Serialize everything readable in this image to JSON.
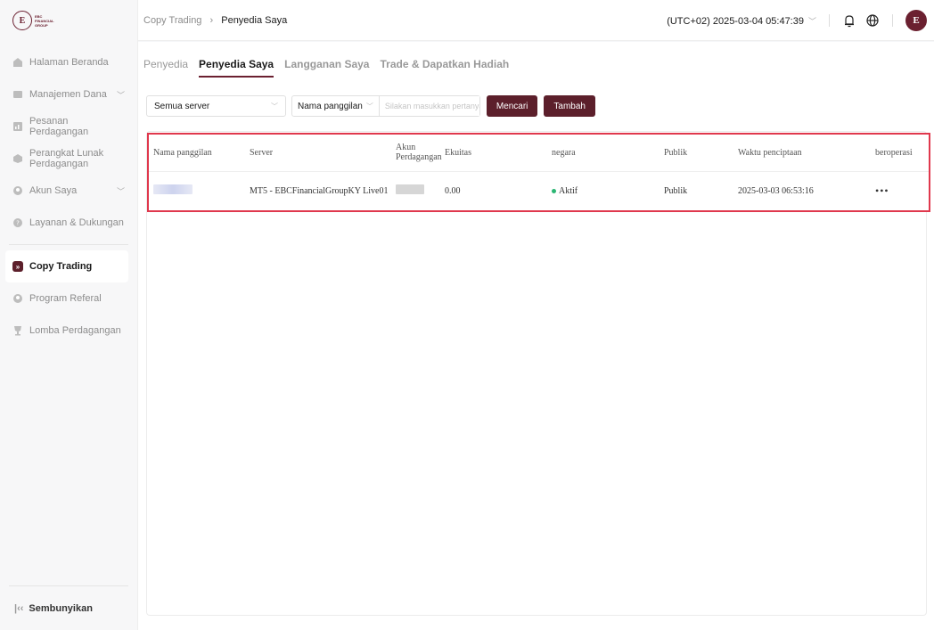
{
  "sidebar": {
    "logo_lines": [
      "EBC",
      "FINANCIAL",
      "GROUP"
    ],
    "items": [
      {
        "label": "Halaman Beranda",
        "icon": "home-icon"
      },
      {
        "label": "Manajemen Dana",
        "icon": "wallet-icon",
        "has_chevron": true
      },
      {
        "label": "Pesanan Perdagangan",
        "icon": "chart-icon"
      },
      {
        "label": "Perangkat Lunak Perdagangan",
        "icon": "software-icon"
      },
      {
        "label": "Akun Saya",
        "icon": "user-icon",
        "has_chevron": true
      },
      {
        "label": "Layanan & Dukungan",
        "icon": "support-icon"
      },
      {
        "label": "Copy Trading",
        "icon": "copy-trading-icon",
        "active": true
      },
      {
        "label": "Program Referal",
        "icon": "referral-icon"
      },
      {
        "label": "Lomba Perdagangan",
        "icon": "trophy-icon"
      }
    ],
    "collapse_label": "Sembunyikan"
  },
  "header": {
    "breadcrumb": [
      "Copy Trading",
      "Penyedia Saya"
    ],
    "timezone": "(UTC+02)  2025-03-04 05:47:39"
  },
  "main": {
    "tabs": [
      {
        "label": "Penyedia"
      },
      {
        "label": "Penyedia Saya",
        "active": true
      },
      {
        "label": "Langganan Saya"
      },
      {
        "label": "Trade & Dapatkan Hadiah"
      }
    ],
    "filters": {
      "server_select": "Semua server",
      "field_select": "Nama panggilan",
      "search_placeholder": "Silakan masukkan pertanyaan",
      "search_button": "Mencari",
      "add_button": "Tambah"
    },
    "table": {
      "columns": [
        "Nama panggilan",
        "Server",
        "Akun Perdagangan",
        "Ekuitas",
        "negara",
        "Publik",
        "Waktu penciptaan",
        "beroperasi"
      ],
      "rows": [
        {
          "server": "MT5 - EBCFinancialGroupKY Live01",
          "equity": "0.00",
          "status": "Aktif",
          "public": "Publik",
          "created": "2025-03-03 06:53:16",
          "action": "•••"
        }
      ]
    }
  },
  "colors": {
    "accent": "#5c1f2b",
    "highlight_border": "#e0384d",
    "status_active": "#2bb673"
  }
}
